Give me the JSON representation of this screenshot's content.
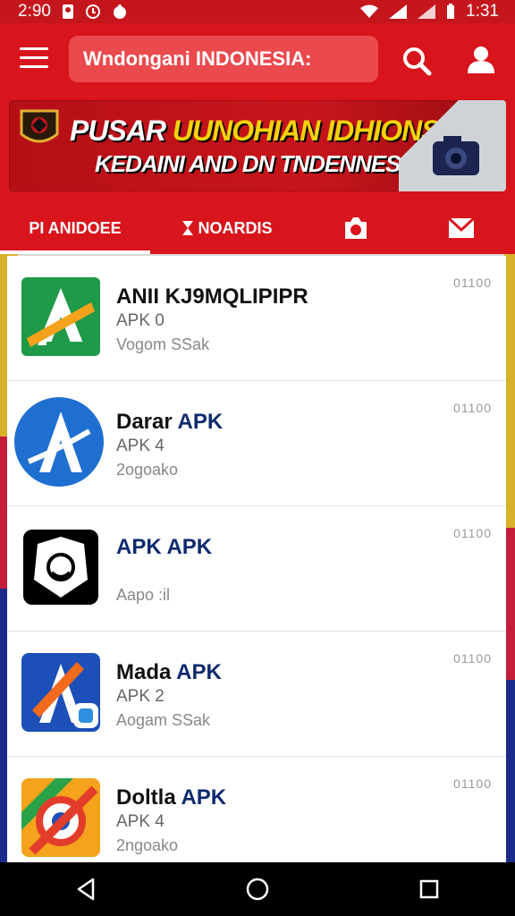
{
  "status_bar": {
    "time_left": "2:90",
    "time_right": "1:31"
  },
  "app_bar": {
    "search_text": "Wndongani INDONESIA:"
  },
  "banner": {
    "line1_part1": "PUSAR",
    "line1_part2": "UUNOHIAN IDHIONSIA",
    "line2": "KEDAINI AND DN TNDENNESI"
  },
  "tabs": [
    {
      "label": "PI ANIDOEE"
    },
    {
      "label": "NOARDIS"
    },
    {
      "icon": "camera-icon"
    },
    {
      "icon": "mail-icon"
    }
  ],
  "apps": [
    {
      "name": "ANII KJ9MQLIPIPR",
      "name_suffix": "",
      "sub": "APK 0",
      "dev": "Vogom SSak",
      "size": "01100",
      "icon": "green-a-icon"
    },
    {
      "name": "Darar",
      "name_suffix": "APK",
      "sub": "APK 4",
      "dev": "2ogoako",
      "size": "01100",
      "icon": "blue-a-icon"
    },
    {
      "name": "APK",
      "name_suffix": "APK",
      "sub": "",
      "dev": "Aapo :il",
      "size": "01100",
      "icon": "black-emblem-icon"
    },
    {
      "name": "Mada",
      "name_suffix": "APK",
      "sub": "APK 2",
      "dev": "Aogam SSak",
      "size": "01100",
      "icon": "blue-orange-a-icon"
    },
    {
      "name": "Doltla",
      "name_suffix": "APK",
      "sub": "APK 4",
      "dev": "2ngoako",
      "size": "01100",
      "icon": "orange-circle-icon"
    }
  ],
  "colors": {
    "primary": "#d8141c",
    "accent_yellow": "#f5d20a",
    "apk_blue": "#0e2a6e"
  }
}
